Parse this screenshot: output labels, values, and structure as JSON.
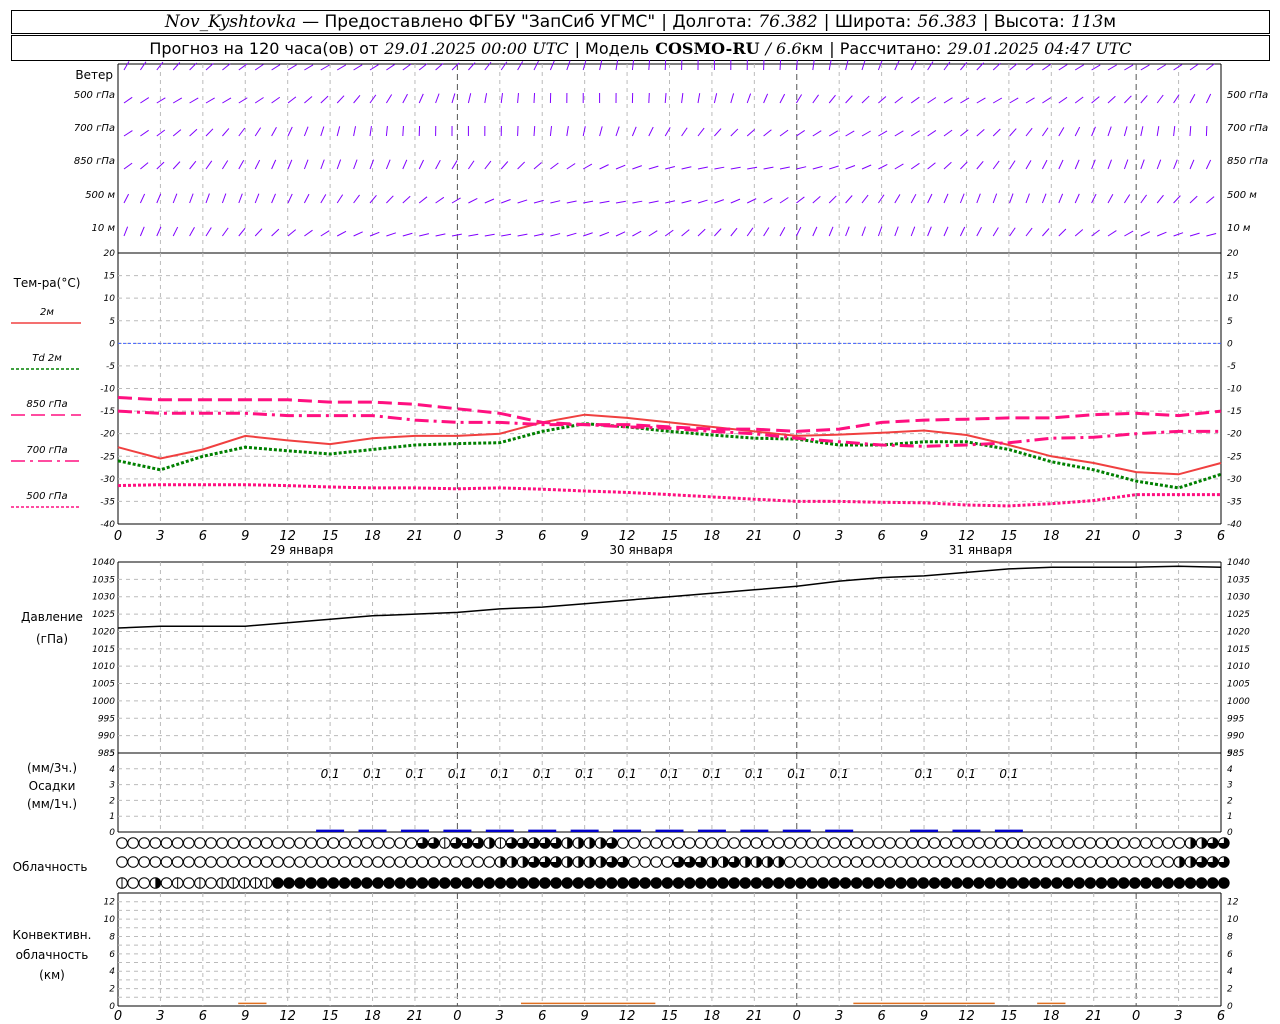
{
  "header": {
    "station": "Nov_Kyshtovka",
    "provider": "— Предоставлено ФГБУ \"ЗапСиб УГМС\"",
    "lon_label": "| Долгота:",
    "lon": "76.382",
    "lat_label": "| Широта:",
    "lat": "56.383",
    "alt_label": "| Высота:",
    "alt": "113",
    "alt_unit": "м",
    "forecast_label": "Прогноз на 120 часа(ов) от",
    "init": "29.01.2025 00:00 UTC",
    "model_label": "| Модель",
    "model": "COSMO-RU",
    "res": "/ 6.6",
    "res_unit": "км",
    "calc_label": "| Рассчитано:",
    "calc": "29.01.2025 04:47 UTC"
  },
  "wind_panel": {
    "title": "Ветер",
    "levels": [
      "500 гПа",
      "700 гПа",
      "850 гПа",
      "500 м",
      "10  м"
    ],
    "color": "#8000ff"
  },
  "chart_data": [
    {
      "type": "line",
      "title": "Тем-ра(°C)",
      "x_hours": [
        0,
        3,
        6,
        9,
        12,
        15,
        18,
        21,
        24,
        27,
        30,
        33,
        36,
        39,
        42,
        45,
        48,
        51,
        54,
        57,
        60,
        63,
        66,
        69,
        72,
        75,
        78
      ],
      "x_tick_labels": [
        "0",
        "3",
        "6",
        "9",
        "12",
        "15",
        "18",
        "21",
        "0",
        "3",
        "6",
        "9",
        "12",
        "15",
        "18",
        "21",
        "0",
        "3",
        "6",
        "9",
        "12",
        "15",
        "18",
        "21",
        "0",
        "3",
        "6"
      ],
      "day_labels": [
        "29 января",
        "30 января",
        "31 января"
      ],
      "ylim": [
        -40,
        20
      ],
      "yticks": [
        "20",
        "15",
        "10",
        "5",
        "0",
        "-5",
        "-10",
        "-15",
        "-20",
        "-25",
        "-30",
        "-35",
        "-40"
      ],
      "grid": true,
      "legend_position": "left",
      "series": [
        {
          "name": "2м",
          "color": "#f04040",
          "style": "solid",
          "values": [
            -23,
            -25.5,
            -23.5,
            -20.5,
            -21.5,
            -22.3,
            -21,
            -20.5,
            -20.5,
            -20,
            -17.5,
            -15.8,
            -16.5,
            -17.5,
            -18.5,
            -19.5,
            -20.5,
            -20.2,
            -19.8,
            -19.3,
            -20.3,
            -22.5,
            -25,
            -26.5,
            -28.5,
            -29,
            -26.5
          ]
        },
        {
          "name": "Td 2м",
          "color": "#008000",
          "style": "dotted",
          "values": [
            -26,
            -28,
            -25,
            -23,
            -23.8,
            -24.5,
            -23.5,
            -22.5,
            -22.2,
            -22,
            -19.5,
            -17.8,
            -18.5,
            -19.5,
            -20.3,
            -21,
            -21.2,
            -22.5,
            -22.5,
            -21.8,
            -21.8,
            -23.5,
            -26.2,
            -28,
            -30.5,
            -32,
            -29
          ]
        },
        {
          "name": "850 гПа",
          "color": "#ff1080",
          "style": "dash",
          "values": [
            -12,
            -12.5,
            -12.5,
            -12.5,
            -12.5,
            -13,
            -13,
            -13.5,
            -14.5,
            -15.5,
            -17.5,
            -18,
            -18,
            -18.5,
            -19,
            -19,
            -19.5,
            -19,
            -17.5,
            -17,
            -16.8,
            -16.5,
            -16.5,
            -15.8,
            -15.5,
            -16,
            -15
          ]
        },
        {
          "name": "700 гПа",
          "color": "#ff1080",
          "style": "dashdot",
          "values": [
            -15,
            -15.5,
            -15.5,
            -15.5,
            -16,
            -16,
            -16,
            -17,
            -17.5,
            -17.5,
            -18,
            -18,
            -18.5,
            -18.8,
            -19.5,
            -20,
            -21,
            -21.8,
            -22.5,
            -22.8,
            -22.5,
            -22,
            -21,
            -20.8,
            -20,
            -19.5,
            -19.5
          ]
        },
        {
          "name": "500 гПа",
          "color": "#ff1080",
          "style": "dotted",
          "values": [
            -31.5,
            -31.3,
            -31.3,
            -31.3,
            -31.5,
            -31.8,
            -32,
            -32,
            -32.2,
            -32,
            -32.3,
            -32.7,
            -33,
            -33.5,
            -34,
            -34.5,
            -35,
            -35,
            -35.2,
            -35.3,
            -35.8,
            -36,
            -35.5,
            -34.8,
            -33.5,
            -33.5,
            -33.5
          ]
        }
      ]
    },
    {
      "type": "line",
      "title": "Давление",
      "ylabel": "(гПа)",
      "x_hours": [
        0,
        3,
        6,
        9,
        12,
        15,
        18,
        21,
        24,
        27,
        30,
        33,
        36,
        39,
        42,
        45,
        48,
        51,
        54,
        57,
        60,
        63,
        66,
        69,
        72,
        75,
        78
      ],
      "ylim": [
        985,
        1040
      ],
      "yticks": [
        "1040",
        "1035",
        "1030",
        "1025",
        "1020",
        "1015",
        "1010",
        "1005",
        "1000",
        "995",
        "990",
        "985"
      ],
      "grid": true,
      "series": [
        {
          "name": "",
          "color": "#000000",
          "style": "solid",
          "values": [
            1021,
            1021.5,
            1021.5,
            1021.5,
            1022.5,
            1023.5,
            1024.5,
            1025,
            1025.5,
            1026.5,
            1027,
            1028,
            1029,
            1030,
            1031,
            1032,
            1033,
            1034.5,
            1035.5,
            1036,
            1037,
            1038,
            1038.5,
            1038.5,
            1038.5,
            1038.8,
            1038.5
          ]
        }
      ]
    },
    {
      "type": "bar",
      "title": "Осадки",
      "ylabel_top": "(мм/3ч.)",
      "ylabel_bottom": "(мм/1ч.)",
      "ylim": [
        0,
        5
      ],
      "yticks": [
        "5",
        "4",
        "3",
        "2",
        "1",
        "0"
      ],
      "grid": true,
      "x_hours": [
        15,
        18,
        21,
        24,
        27,
        30,
        33,
        36,
        39,
        42,
        45,
        48,
        51,
        57,
        60,
        63
      ],
      "values": [
        "0.1",
        "0.1",
        "0.1",
        "0.1",
        "0.1",
        "0.1",
        "0.1",
        "0.1",
        "0.1",
        "0.1",
        "0.1",
        "0.1",
        "0.1",
        "0.1",
        "0.1",
        "0.1"
      ],
      "color": "#0000cc"
    },
    {
      "type": "table",
      "title": "Облачность",
      "rows": [
        "0000000000000000000000000003313332133333222230000000000000000000000000000000000000000000000000002233",
        "0000000000000000000000000000000000222333222233000033322322220000000000000000000000000000000000022333",
        "1002010101111144444444444444444444444444444444444444444444444444444444444444444444444444444444444444"
      ]
    },
    {
      "type": "area",
      "title": "Конвективн. облачность",
      "ylabel": "(км)",
      "ylim": [
        0,
        12
      ],
      "yticks": [
        "12",
        "10",
        "8",
        "6",
        "4",
        "2",
        "0"
      ],
      "grid": true,
      "segments_hours": [
        [
          8.5,
          10.5
        ],
        [
          28.5,
          38
        ],
        [
          52,
          62
        ],
        [
          65,
          67
        ]
      ],
      "height_km": 0.3,
      "color": "#e07020"
    }
  ]
}
